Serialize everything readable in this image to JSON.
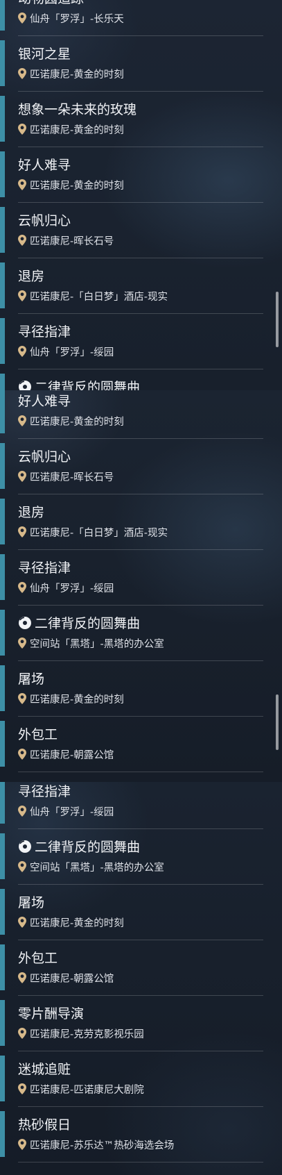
{
  "panels": [
    {
      "items": [
        {
          "title": "动物园追踪",
          "location": "仙舟「罗浮」-长乐天",
          "icon": "location-pin-icon"
        },
        {
          "title": "银河之星",
          "location": "匹诺康尼-黄金的时刻",
          "icon": "location-pin-icon"
        },
        {
          "title": "想象一朵未来的玫瑰",
          "location": "匹诺康尼-黄金的时刻",
          "icon": "location-pin-icon"
        },
        {
          "title": "好人难寻",
          "location": "匹诺康尼-黄金的时刻",
          "icon": "location-pin-icon"
        },
        {
          "title": "云帆归心",
          "location": "匹诺康尼-晖长石号",
          "icon": "location-pin-icon"
        },
        {
          "title": "退房",
          "location": "匹诺康尼-「白日梦」酒店-现实",
          "icon": "location-pin-icon"
        },
        {
          "title": "寻径指津",
          "location": "仙舟「罗浮」-绥园",
          "icon": "location-pin-icon"
        },
        {
          "title": "二律背反的圆舞曲",
          "location": "",
          "icon": "location-pin-icon",
          "badge": "disc-icon"
        }
      ]
    },
    {
      "items": [
        {
          "title": "好人难寻",
          "location": "匹诺康尼-黄金的时刻",
          "icon": "location-pin-icon"
        },
        {
          "title": "云帆归心",
          "location": "匹诺康尼-晖长石号",
          "icon": "location-pin-icon"
        },
        {
          "title": "退房",
          "location": "匹诺康尼-「白日梦」酒店-现实",
          "icon": "location-pin-icon"
        },
        {
          "title": "寻径指津",
          "location": "仙舟「罗浮」-绥园",
          "icon": "location-pin-icon"
        },
        {
          "title": "二律背反的圆舞曲",
          "location": "空间站「黑塔」-黑塔的办公室",
          "icon": "location-pin-icon",
          "badge": "disc-icon"
        },
        {
          "title": "屠场",
          "location": "匹诺康尼-黄金的时刻",
          "icon": "location-pin-icon"
        },
        {
          "title": "外包工",
          "location": "匹诺康尼-朝露公馆",
          "icon": "location-pin-icon"
        }
      ]
    },
    {
      "items": [
        {
          "title": "寻径指津",
          "location": "仙舟「罗浮」-绥园",
          "icon": "location-pin-icon"
        },
        {
          "title": "二律背反的圆舞曲",
          "location": "空间站「黑塔」-黑塔的办公室",
          "icon": "location-pin-icon",
          "badge": "disc-icon"
        },
        {
          "title": "屠场",
          "location": "匹诺康尼-黄金的时刻",
          "icon": "location-pin-icon"
        },
        {
          "title": "外包工",
          "location": "匹诺康尼-朝露公馆",
          "icon": "location-pin-icon"
        },
        {
          "title": "零片酬导演",
          "location": "匹诺康尼-克劳克影视乐园",
          "icon": "location-pin-icon"
        },
        {
          "title": "迷城追赃",
          "location": "匹诺康尼-匹诺康尼大剧院",
          "icon": "location-pin-icon"
        },
        {
          "title": "热砂假日",
          "location": "匹诺康尼-苏乐达™热砂海选会场",
          "icon": "location-pin-icon"
        }
      ]
    }
  ],
  "colors": {
    "accent": "#3d8fa6",
    "pin": "#d7b98a",
    "title": "#f1f3f6",
    "location": "#dfe2e8"
  }
}
